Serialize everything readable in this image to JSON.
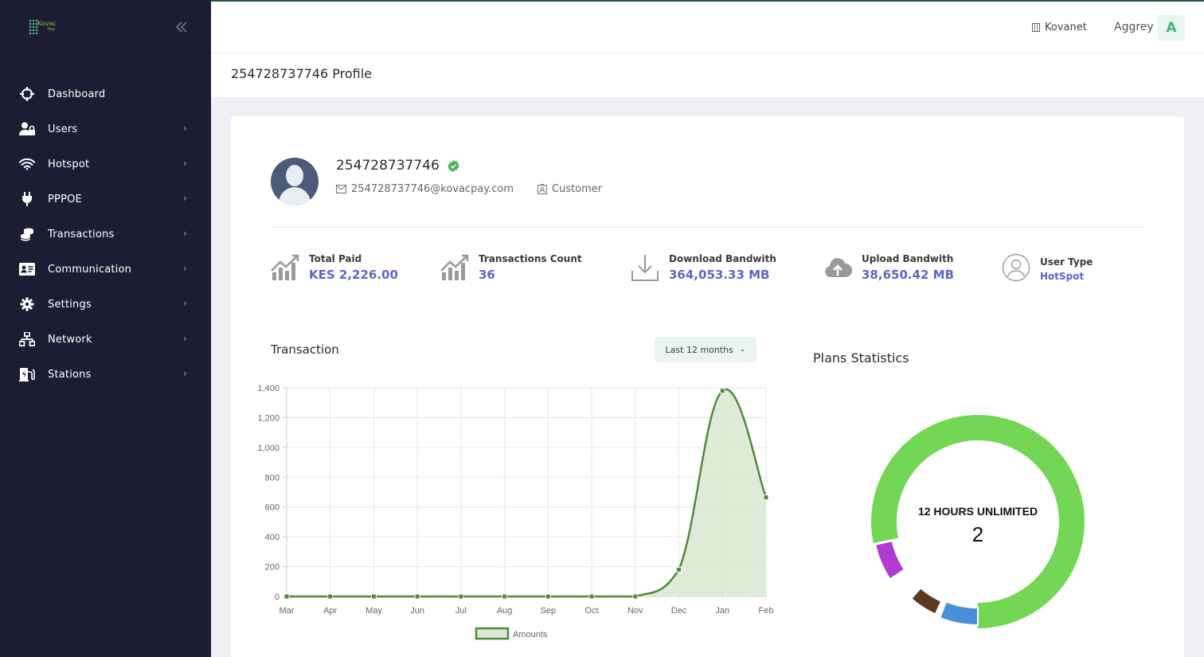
{
  "sidebar": {
    "brand": {
      "logo_text": "Kovac",
      "logo_sub": "Pay"
    },
    "collapse_icon": "double-chevron-left-icon",
    "items": [
      {
        "label": "Dashboard",
        "icon": "crosshair-icon",
        "has_submenu": false
      },
      {
        "label": "Users",
        "icon": "users-lock-icon",
        "has_submenu": true
      },
      {
        "label": "Hotspot",
        "icon": "wifi-icon",
        "has_submenu": true
      },
      {
        "label": "PPPOE",
        "icon": "plug-icon",
        "has_submenu": true
      },
      {
        "label": "Transactions",
        "icon": "coins-icon",
        "has_submenu": true
      },
      {
        "label": "Communication",
        "icon": "id-card-icon",
        "has_submenu": true
      },
      {
        "label": "Settings",
        "icon": "gear-icon",
        "has_submenu": true
      },
      {
        "label": "Network",
        "icon": "network-icon",
        "has_submenu": true
      },
      {
        "label": "Stations",
        "icon": "charging-station-icon",
        "has_submenu": true
      }
    ]
  },
  "header": {
    "org": "Kovanet",
    "user": "Aggrey",
    "avatar_letter": "A"
  },
  "page": {
    "title": "254728737746 Profile"
  },
  "profile": {
    "name": "254728737746",
    "email": "254728737746@kovacpay.com",
    "role": "Customer",
    "stats": [
      {
        "label": "Total Paid",
        "value": "KES 2,226.00",
        "icon": "trend-chart-icon"
      },
      {
        "label": "Transactions Count",
        "value": "36",
        "icon": "trend-chart-icon"
      },
      {
        "label": "Download Bandwith",
        "value": "364,053.33 MB",
        "icon": "download-icon"
      },
      {
        "label": "Upload Bandwith",
        "value": "38,650.42 MB",
        "icon": "cloud-upload-icon"
      },
      {
        "label": "User Type",
        "value": "HotSpot",
        "icon": "user-circle-icon"
      }
    ]
  },
  "transaction_card": {
    "title": "Transaction",
    "period_label": "Last 12 months"
  },
  "plans_card": {
    "title": "Plans Statistics",
    "center_label": "12 HOURS UNLIMITED",
    "center_value": "2"
  },
  "colors": {
    "sidebar_bg": "#1c1d33",
    "accent": "#5b66c7",
    "line": "#4f8a3a",
    "area": "#d9e8d2",
    "donut_main": "#74d655",
    "donut_purple": "#b23bd1",
    "donut_blue": "#4a90d9",
    "donut_brown": "#5a3a22"
  },
  "chart_data": [
    {
      "type": "area",
      "title": "Transaction",
      "categories": [
        "Mar",
        "Apr",
        "May",
        "Jun",
        "Jul",
        "Aug",
        "Sep",
        "Oct",
        "Nov",
        "Dec",
        "Jan",
        "Feb"
      ],
      "series": [
        {
          "name": "Amounts",
          "values": [
            0,
            0,
            0,
            0,
            0,
            0,
            0,
            0,
            0,
            180,
            1380,
            665
          ]
        }
      ],
      "ylim": [
        0,
        1400
      ],
      "yticks": [
        0,
        200,
        400,
        600,
        800,
        1000,
        1200,
        1400
      ],
      "ytick_labels": [
        "0",
        "200",
        "400",
        "600",
        "800",
        "1,000",
        "1,200",
        "1,400"
      ],
      "grid": true,
      "legend": "bottom"
    },
    {
      "type": "pie",
      "title": "Plans Statistics",
      "donut": true,
      "center_label": "12 HOURS UNLIMITED",
      "center_value": 2,
      "slices": [
        {
          "share": 0.765,
          "color": "#74d655"
        },
        {
          "share": 0.085,
          "color": "#b23bd1"
        },
        {
          "share": 0.06,
          "color": "#4a90d9"
        },
        {
          "share": 0.045,
          "color": "#5a3a22"
        }
      ]
    }
  ]
}
